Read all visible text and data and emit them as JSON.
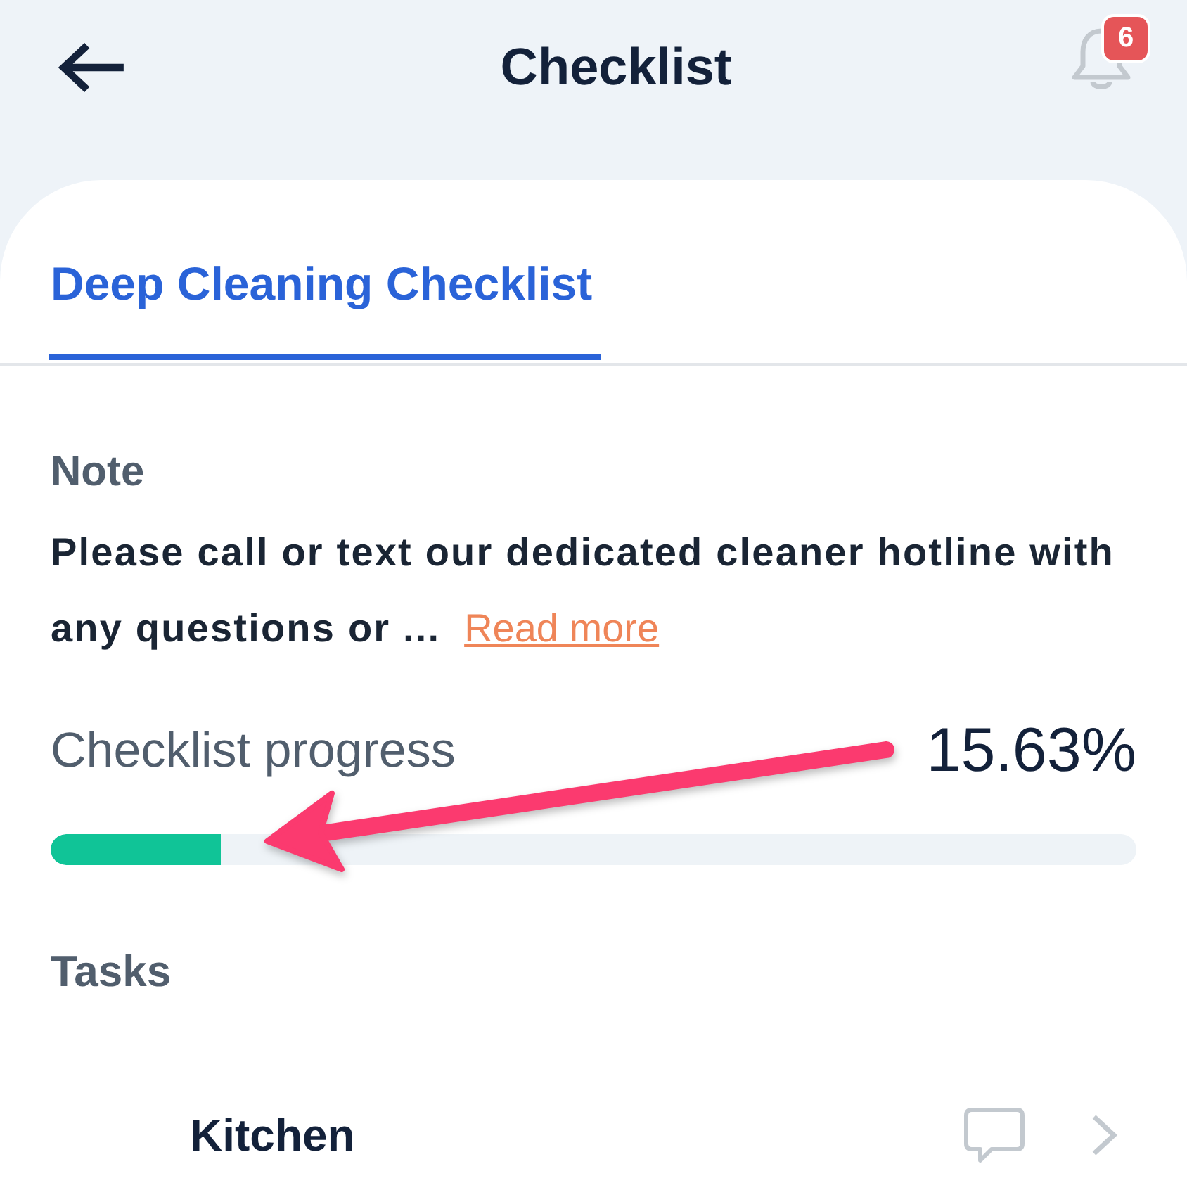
{
  "header": {
    "title": "Checklist",
    "notification_count": "6"
  },
  "tabs": [
    {
      "label": "Deep Cleaning Checklist",
      "selected": true
    }
  ],
  "note": {
    "heading": "Note",
    "text": "Please call or text our dedicated cleaner hotline with any questions or ...",
    "link": "Read more"
  },
  "progress": {
    "label": "Checklist progress",
    "reading": "15.63%",
    "level": 0.1563
  },
  "tasks": {
    "heading": "Tasks",
    "items": [
      {
        "name": "Kitchen"
      }
    ]
  },
  "annotations": [
    {
      "kind": "arrow"
    }
  ]
}
